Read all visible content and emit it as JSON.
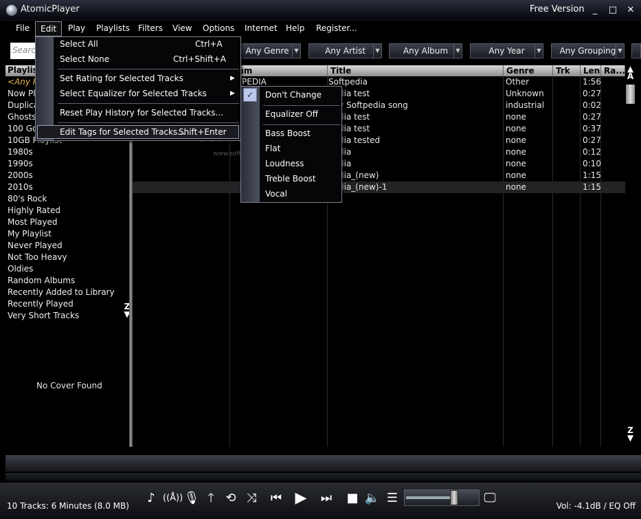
{
  "window": {
    "title": "AtomicPlayer",
    "edition": "Free Version",
    "buttons": [
      "_",
      "□",
      "✕"
    ]
  },
  "menubar": [
    "File",
    "Edit",
    "Play",
    "Playlists",
    "Filters",
    "View",
    "Options",
    "Internet",
    "Help",
    "Register..."
  ],
  "toolbar": {
    "search_placeholder": "Search",
    "filters": [
      "Any Genre",
      "Any Artist",
      "Any Album",
      "Any Year",
      "Any Grouping"
    ]
  },
  "left_panel": {
    "header": "Playlist",
    "items": [
      "<Any Pl",
      "Now Pl",
      "Duplica",
      "Ghosts",
      "100 Go",
      "10GB Playlist",
      "1980s",
      "1990s",
      "2000s",
      "2010s",
      "80's Rock",
      "Highly Rated",
      "Most Played",
      "My Playlist",
      "Never Played",
      "Not Too Heavy",
      "Oldies",
      "Random Albums",
      "Recently Added to Library",
      "Recently Played",
      "Very Short Tracks"
    ],
    "az": "Z",
    "cover_text": "No Cover Found"
  },
  "tracklist": {
    "columns": [
      "oum",
      "Title",
      "Genre",
      "Trk",
      "Len",
      "Ra..."
    ],
    "rows": [
      {
        "album": "FTPEDIA",
        "title": "Softpedia",
        "genre": "Other",
        "trk": "",
        "len": "1:56"
      },
      {
        "album": "",
        "title": "pedia test",
        "genre": "Unknown",
        "trk": "",
        "len": "0:27"
      },
      {
        "album": "",
        "title": "ppy Softpedia song",
        "genre": "industrial",
        "trk": "",
        "len": "0:02"
      },
      {
        "album": "",
        "title": "pedia test",
        "genre": "none",
        "trk": "",
        "len": "0:27"
      },
      {
        "album": "",
        "title": "pedia test",
        "genre": "none",
        "trk": "",
        "len": "0:37"
      },
      {
        "album": "",
        "title": "pedia tested",
        "genre": "none",
        "trk": "",
        "len": "0:27"
      },
      {
        "album": "",
        "title": "pedia",
        "genre": "none",
        "trk": "",
        "len": "0:12"
      },
      {
        "album": "",
        "title": "pedia",
        "genre": "none",
        "trk": "",
        "len": "0:10"
      },
      {
        "album": "",
        "title": "pedia_(new)",
        "genre": "none",
        "trk": "",
        "len": "1:15"
      },
      {
        "album": "",
        "title": "pedia_(new)-1",
        "genre": "none",
        "trk": "",
        "len": "1:15"
      }
    ],
    "scroll_top": "A",
    "scroll_bottom": "Z"
  },
  "edit_menu": {
    "items": [
      {
        "label": "Select All",
        "shortcut": "Ctrl+A"
      },
      {
        "label": "Select None",
        "shortcut": "Ctrl+Shift+A"
      },
      {
        "label": "Set Rating for Selected Tracks",
        "shortcut": ""
      },
      {
        "label": "Select Equalizer for Selected Tracks",
        "shortcut": ""
      },
      {
        "label": "Reset Play History for Selected Tracks...",
        "shortcut": ""
      },
      {
        "label": "Edit Tags for Selected Tracks...",
        "shortcut": "Shift+Enter"
      }
    ]
  },
  "equalizer_menu": {
    "items": [
      "Don't Change",
      "Equalizer Off",
      "Bass Boost",
      "Flat",
      "Loudness",
      "Treble Boost",
      "Vocal"
    ],
    "checked": "Don't Change"
  },
  "watermark": {
    "main": "SOFTPEDIA",
    "sub": "www.softpedia.com"
  },
  "status": {
    "left": "10 Tracks: 6 Minutes (8.0 MB)",
    "right": "Vol: -4.1dB / EQ Off"
  },
  "volume_level": 0.7,
  "controls": [
    "note-icon",
    "broadcast-icon",
    "mic-icon",
    "up-arrow-icon",
    "repeat-icon",
    "shuffle-icon",
    "previous-icon",
    "play-icon",
    "next-icon",
    "stop-icon",
    "volume-icon",
    "equalizer-icon",
    "monitor-icon"
  ]
}
